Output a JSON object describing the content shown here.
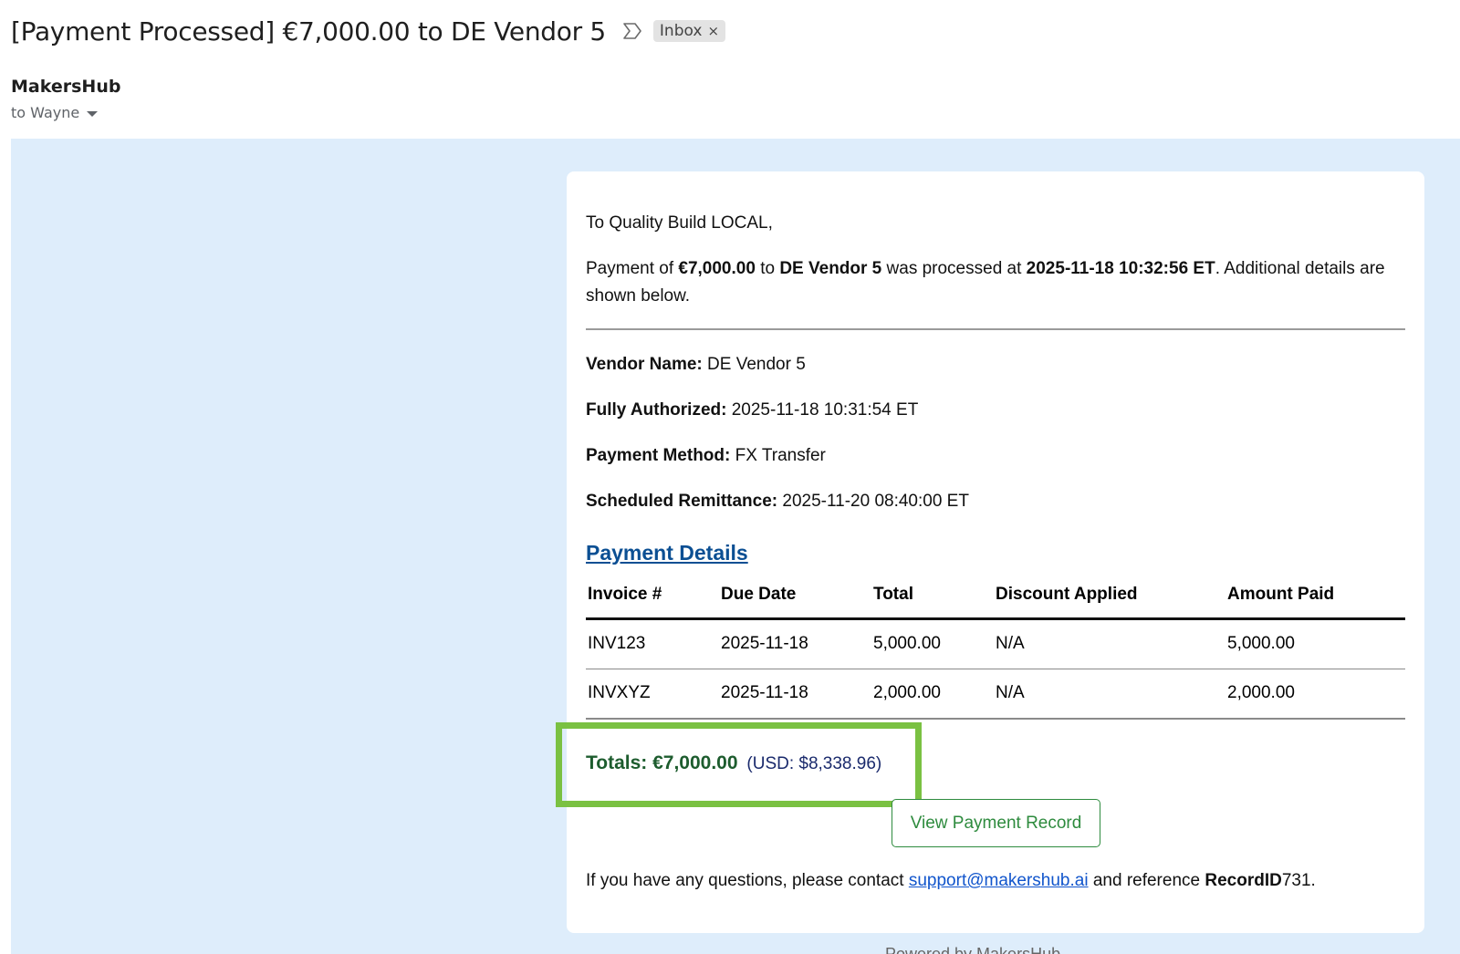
{
  "email": {
    "subject": "[Payment Processed] €7,000.00 to DE Vendor 5",
    "label_chip": "Inbox",
    "label_chip_close": "×",
    "sender": "MakersHub",
    "recipient_line": "to Wayne"
  },
  "body": {
    "greeting": "To Quality Build LOCAL,",
    "intro": {
      "t1": "Payment of ",
      "amount": "€7,000.00",
      "t2": " to ",
      "vendor": "DE Vendor 5",
      "t3": " was processed at ",
      "processed_at": "2025-11-18 10:32:56 ET",
      "t4": ". Additional details are shown below."
    },
    "fields": [
      {
        "label": "Vendor Name:",
        "value": " DE Vendor 5"
      },
      {
        "label": "Fully Authorized:",
        "value": " 2025-11-18 10:31:54 ET"
      },
      {
        "label": "Payment Method:",
        "value": " FX Transfer"
      },
      {
        "label": "Scheduled Remittance:",
        "value": " 2025-11-20 08:40:00 ET"
      }
    ],
    "section_title": "Payment Details",
    "table": {
      "headers": [
        "Invoice #",
        "Due Date",
        "Total",
        "Discount Applied",
        "Amount Paid"
      ],
      "rows": [
        [
          "INV123",
          "2025-11-18",
          "5,000.00",
          "N/A",
          "5,000.00"
        ],
        [
          "INVXYZ",
          "2025-11-18",
          "2,000.00",
          "N/A",
          "2,000.00"
        ]
      ]
    },
    "totals": {
      "main": "Totals: €7,000.00",
      "usd": "(USD: $8,338.96)"
    },
    "button_label": "View Payment Record",
    "footer": {
      "t1": "If you have any questions, please contact ",
      "email_link": "support@makershub.ai",
      "t2": " and reference ",
      "record_label": "RecordID",
      "record_id": "731."
    },
    "cut_text": "Powered by MakersHub"
  },
  "colors": {
    "mail_background": "#deedfb",
    "highlight_border": "#7ac142",
    "section_title": "#0b4f93",
    "totals_green": "#1d5c2e",
    "button_green": "#2e8b3e",
    "link_blue": "#1155cc"
  }
}
